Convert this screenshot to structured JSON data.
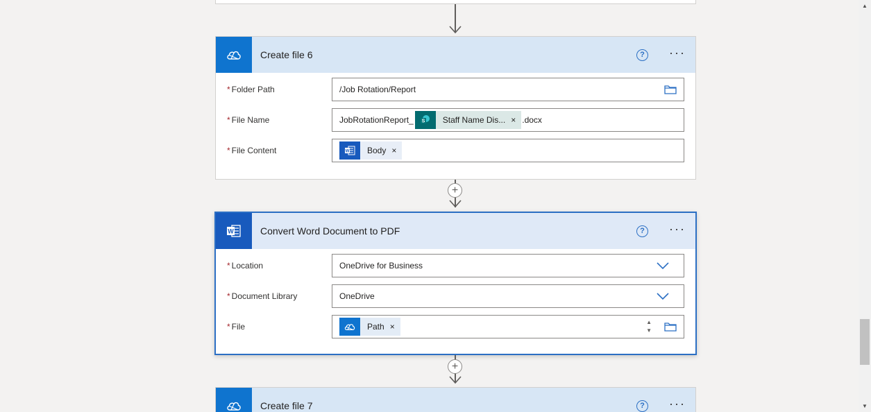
{
  "flow": {
    "card_create_file_6": {
      "title": "Create file 6",
      "fields": {
        "folder_path": {
          "label": "Folder Path",
          "value": "/Job Rotation/Report"
        },
        "file_name": {
          "label": "File Name",
          "prefix": "JobRotationReport_",
          "token_label": "Staff Name Dis...",
          "suffix": ".docx"
        },
        "file_content": {
          "label": "File Content",
          "token_label": "Body"
        }
      }
    },
    "card_convert": {
      "title": "Convert Word Document to PDF",
      "fields": {
        "location": {
          "label": "Location",
          "value": "OneDrive for Business"
        },
        "document_library": {
          "label": "Document Library",
          "value": "OneDrive"
        },
        "file": {
          "label": "File",
          "token_label": "Path"
        }
      }
    },
    "card_create_file_7": {
      "title": "Create file 7"
    }
  },
  "common": {
    "required_mark": "*",
    "help_glyph": "?",
    "more_glyph": "···",
    "token_remove": "×",
    "add_step_glyph": "+"
  },
  "icons": {
    "onedrive": "onedrive-icon",
    "word": "word-icon",
    "sharepoint": "sharepoint-icon",
    "folder": "folder-icon",
    "chevron": "chevron-down-icon",
    "help": "help-icon",
    "more": "more-options-icon"
  },
  "colors": {
    "accent": "#2b6fc4",
    "onedrive": "#0f74cf",
    "word": "#185abd",
    "sharepoint": "#036c70",
    "required": "#a4262c"
  }
}
